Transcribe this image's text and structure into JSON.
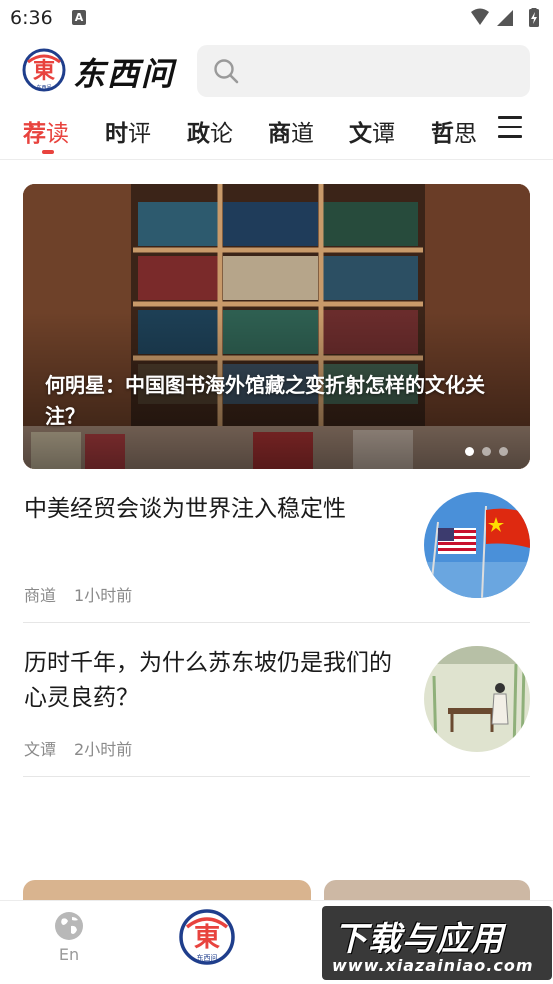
{
  "status_bar": {
    "time": "6:36",
    "notification_icon": "A"
  },
  "header": {
    "logo_text": "东西问",
    "logo_mark_text": "東",
    "logo_sub_text": "东西问",
    "search_placeholder": ""
  },
  "tabs": [
    {
      "first": "荐",
      "rest": "读",
      "active": true
    },
    {
      "first": "时",
      "rest": "评",
      "active": false
    },
    {
      "first": "政",
      "rest": "论",
      "active": false
    },
    {
      "first": "商",
      "rest": "道",
      "active": false
    },
    {
      "first": "文",
      "rest": "谭",
      "active": false
    },
    {
      "first": "哲",
      "rest": "思",
      "active": false
    }
  ],
  "banner": {
    "title": "何明星：中国图书海外馆藏之变折射怎样的文化关注？",
    "dot_count": 3,
    "active_dot": 0
  },
  "news": [
    {
      "title": "中美经贸会谈为世界注入稳定性",
      "category": "商道",
      "time": "1小时前",
      "thumb": "us-china-flags"
    },
    {
      "title": "历时千年，为什么苏东坡仍是我们的心灵良药？",
      "category": "文谭",
      "time": "2小时前",
      "thumb": "ink-painting"
    }
  ],
  "bottom_nav": {
    "en_label": "En",
    "home_sub_text": "东西问"
  },
  "watermark": {
    "main": "下载与应用",
    "url": "www.xiazainiao.com"
  },
  "colors": {
    "accent": "#e8433e",
    "text": "#1a1a1a",
    "meta": "#8a8a8a",
    "logo_blue": "#1f3e8c"
  }
}
